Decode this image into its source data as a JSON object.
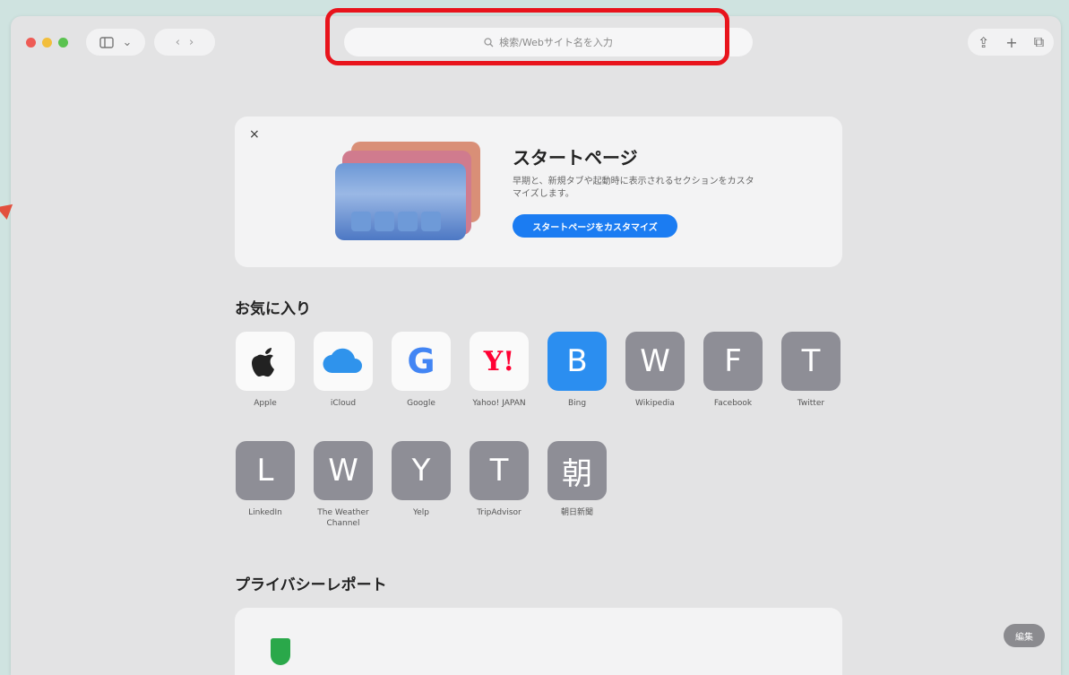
{
  "toolbar": {
    "sidebar_icon": "sidebar-icon",
    "chevron": "⌄",
    "back": "‹",
    "forward": "›",
    "address_placeholder": "検索/Webサイト名を入力",
    "share": "⇪",
    "new_tab": "+",
    "tabs_overview": "⧉"
  },
  "start_card": {
    "close": "×",
    "title": "スタートページ",
    "description": "早期と、新規タブや起動時に表示されるセクションをカスタマイズします。",
    "button": "スタートページをカスタマイズ"
  },
  "favorites": {
    "title": "お気に入り",
    "items": [
      {
        "glyph": "",
        "label": "Apple"
      },
      {
        "glyph": "☁",
        "label": "iCloud"
      },
      {
        "glyph": "G",
        "label": "Google"
      },
      {
        "glyph": "Y!",
        "label": "Yahoo! JAPAN"
      },
      {
        "glyph": "B",
        "label": "Bing"
      },
      {
        "glyph": "W",
        "label": "Wikipedia"
      },
      {
        "glyph": "F",
        "label": "Facebook"
      },
      {
        "glyph": "T",
        "label": "Twitter"
      },
      {
        "glyph": "L",
        "label": "LinkedIn"
      },
      {
        "glyph": "W",
        "label": "The Weather Channel"
      },
      {
        "glyph": "Y",
        "label": "Yelp"
      },
      {
        "glyph": "T",
        "label": "TripAdvisor"
      },
      {
        "glyph": "朝",
        "label": "朝日新聞"
      }
    ]
  },
  "privacy": {
    "title": "プライバシーレポート"
  },
  "edit_button": "編集"
}
